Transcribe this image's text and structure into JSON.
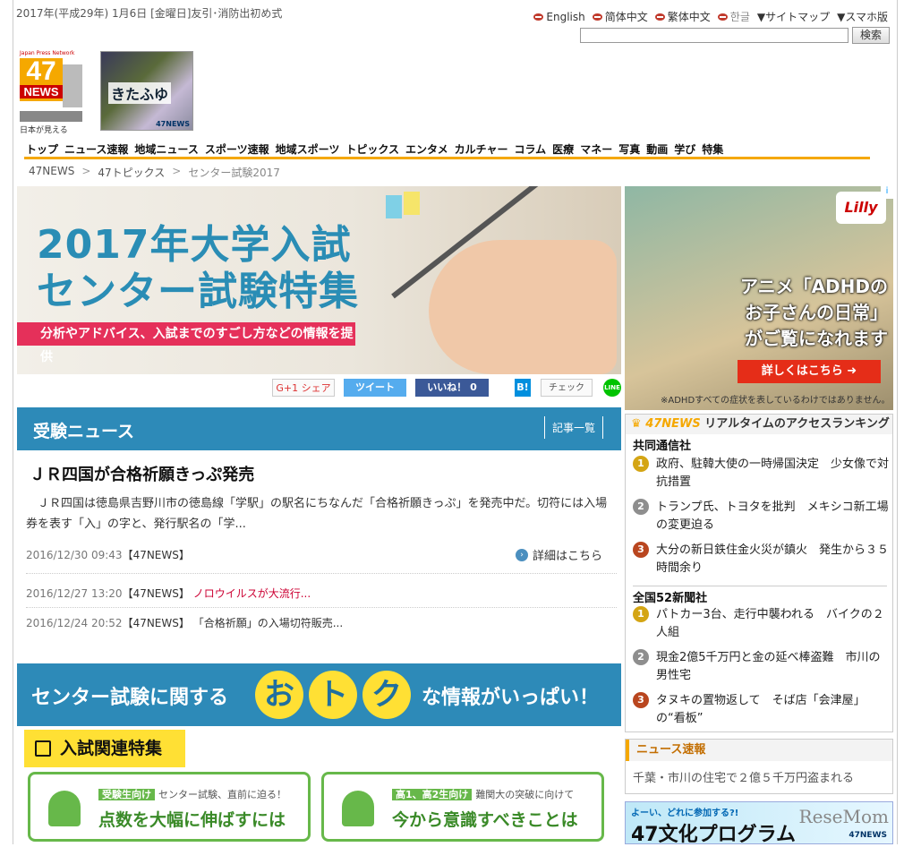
{
  "header": {
    "date": "2017年(平成29年) 1月6日 [金曜日]友引･消防出初め式",
    "langs": [
      "English",
      "简体中文",
      "繁体中文",
      "한글"
    ],
    "sitemap": "▼サイトマップ",
    "mobile": "▼スマホ版",
    "search_button": "検索",
    "logo_caption": "Japan Press Network",
    "logo_number": "47",
    "logo_word": "NEWS",
    "logo_sub": "日本が見える",
    "season_text": "きたふゆ",
    "season_sub": "47NEWS"
  },
  "nav": [
    "トップ",
    "ニュース速報",
    "地域ニュース",
    "スポーツ速報",
    "地域スポーツ",
    "トピックス",
    "エンタメ",
    "カルチャー",
    "コラム",
    "医療",
    "マネー",
    "写真",
    "動画",
    "学び",
    "特集"
  ],
  "breadcrumb": [
    "47NEWS",
    "47トピックス",
    "センター試験2017"
  ],
  "hero": {
    "line1": "2017年大学入試",
    "line2": "センター試験特集",
    "bar": "分析やアドバイス、入試までのすごし方などの情報を提供"
  },
  "ad": {
    "brand": "Lilly",
    "lines": [
      "アニメ「ADHDの",
      "お子さんの日常」",
      "がご覧になれます"
    ],
    "button": "詳しくはこちら ➜",
    "note": "※ADHDすべての症状を表しているわけではありません。"
  },
  "social": {
    "gplus": "G+1 シェア",
    "tweet": "ツイート",
    "like": "いいね！ 0",
    "hatena": "B!",
    "check": "チェック",
    "line": "LINE"
  },
  "news": {
    "heading": "受験ニュース",
    "more": "記事一覧",
    "article_title": "ＪＲ四国が合格祈願きっぷ発売",
    "article_body": "　ＪＲ四国は徳島県吉野川市の徳島線「学駅」の駅名にちなんだ「合格祈願きっぷ」を発売中だ。切符には入場券を表す「入」の字と、発行駅名の「学...",
    "article_date": "2016/12/30 09:43",
    "article_src": "【47NEWS】",
    "detail": "詳細はこちら",
    "items": [
      {
        "date": "2016/12/27 13:20",
        "src": "【47NEWS】",
        "title": "ノロウイルスが大流行..."
      },
      {
        "date": "2016/12/24 20:52",
        "src": "【47NEWS】",
        "title": "「合格祈願」の入場切符販売..."
      }
    ]
  },
  "otoku": {
    "left": "センター試験に関する",
    "c1": "お",
    "c2": "ト",
    "c3": "ク",
    "right": "な情報がいっぱい！"
  },
  "features": {
    "heading": "入試関連特集",
    "cards": [
      {
        "tag": "受験生向け",
        "sub": "センター試験、直前に迫る！",
        "big": "点数を大幅に伸ばすには"
      },
      {
        "tag": "高1、高2生向け",
        "sub": "難関大の突破に向けて",
        "big": "今から意識すべきことは"
      }
    ]
  },
  "ranking": {
    "brand": "47NEWS",
    "heading": "リアルタイムのアクセスランキング",
    "sections": [
      {
        "name": "共同通信社",
        "items": [
          "政府、駐韓大使の一時帰国決定　少女像で対抗措置",
          "トランプ氏、トヨタを批判　メキシコ新工場の変更迫る",
          "大分の新日鉄住金火災が鎮火　発生から３５時間余り"
        ]
      },
      {
        "name": "全国52新聞社",
        "items": [
          "パトカー3台、走行中襲われる　バイクの２人組",
          "現金2億5千万円と金の延べ棒盗難　市川の男性宅",
          "タヌキの置物返して　そば店「会津屋」の“看板”"
        ]
      }
    ],
    "medals": [
      "1",
      "2",
      "3"
    ]
  },
  "sokuho": {
    "heading": "ニュース速報",
    "item": "千葉・市川の住宅で２億５千万円盗まれる"
  },
  "bunka": {
    "q": "よーい、どれに参加する?!",
    "title": "47文化プログラム",
    "resemom": "ReseMom",
    "sub": "47NEWS"
  }
}
